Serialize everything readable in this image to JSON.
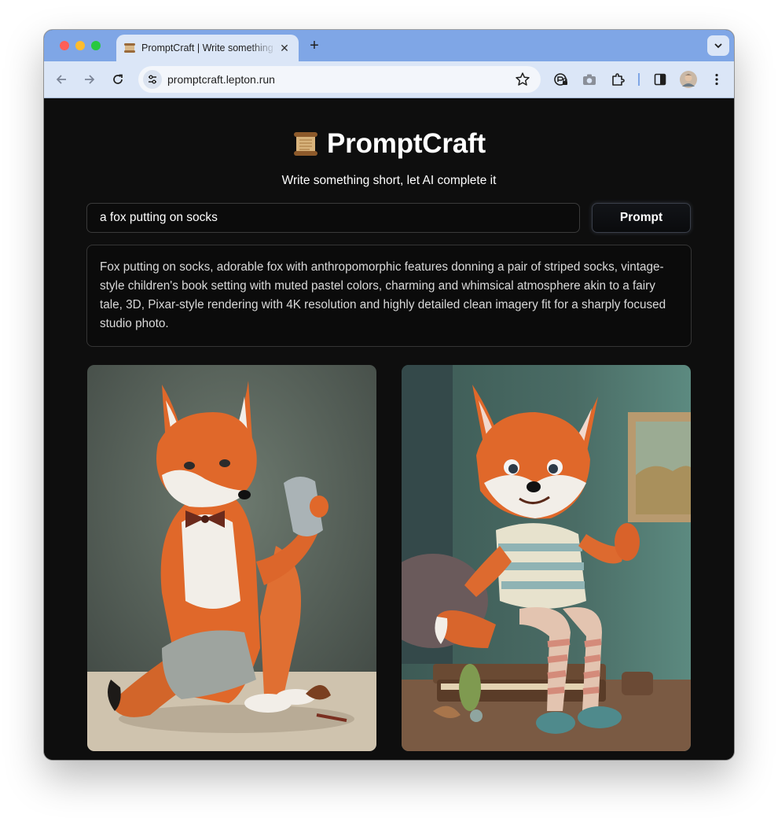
{
  "browser": {
    "tab_title": "PromptCraft | Write something short, let AI complete it",
    "tab_close_glyph": "✕",
    "new_tab_glyph": "+",
    "url": "promptcraft.lepton.run",
    "icons": [
      "back-icon",
      "forward-icon",
      "reload-icon",
      "site-info-icon",
      "bookmark-star-icon",
      "incognito-lock-icon",
      "camera-icon",
      "extensions-icon",
      "side-panel-icon",
      "profile-avatar",
      "more-menu-icon",
      "tab-search-chevron-icon"
    ]
  },
  "page": {
    "title": "PromptCraft",
    "subtitle": "Write something short, let AI complete it",
    "input_value": "a fox putting on socks",
    "button_label": "Prompt",
    "result_text": "Fox putting on socks, adorable fox with anthropomorphic features donning a pair of striped socks, vintage-style children's book setting with muted pastel colors, charming and whimsical atmosphere akin to a fairy tale, 3D, Pixar-style rendering with 4K resolution and highly detailed clean imagery fit for a sharply focused studio photo."
  },
  "images": [
    {
      "subject": "fox with bow tie holding a gray sock"
    },
    {
      "subject": "fox in striped shirt and striped socks sitting on books"
    }
  ],
  "colors": {
    "tabstrip": "#7fa6e6",
    "toolbar": "#dbe6f7",
    "page_background": "#0e0e0e",
    "fox_orange": "#e0682a"
  }
}
